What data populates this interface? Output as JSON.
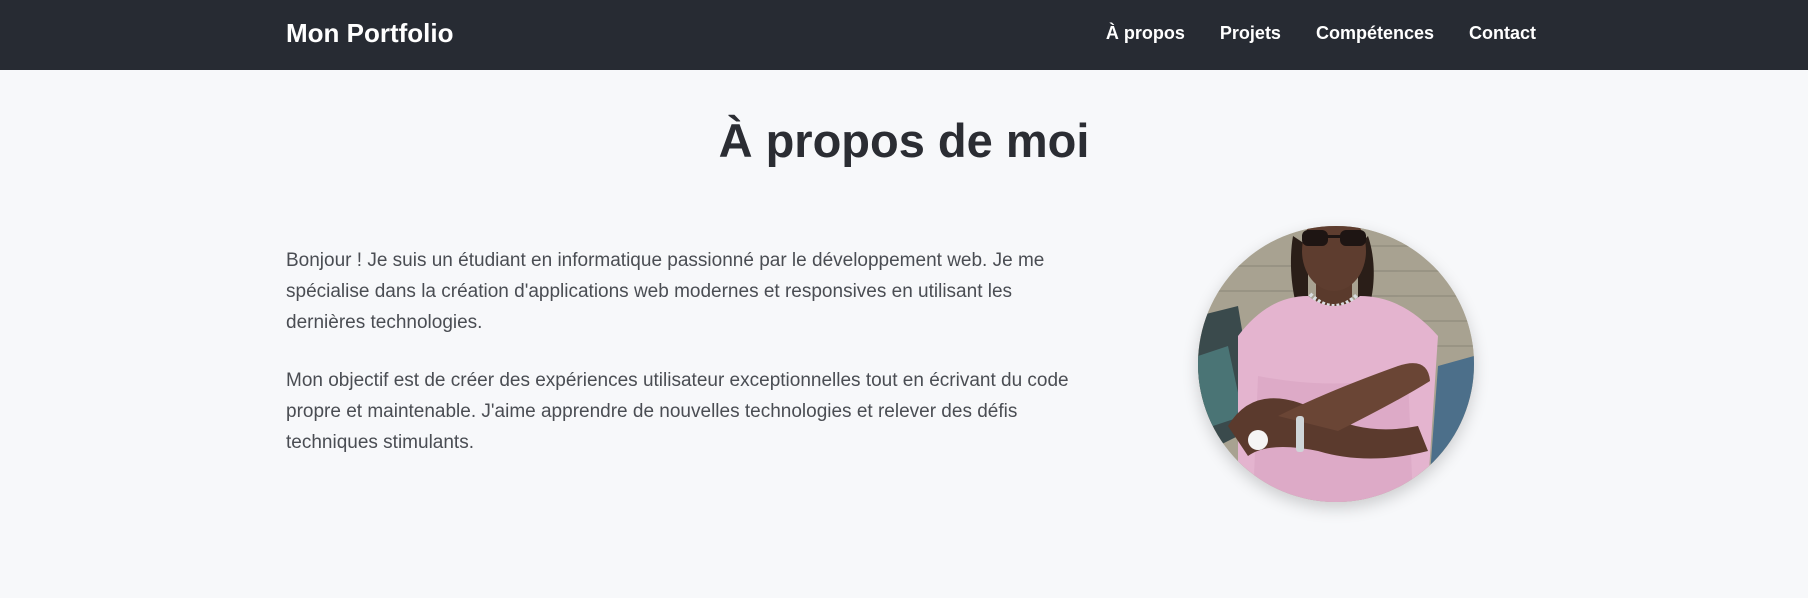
{
  "navbar": {
    "brand": "Mon Portfolio",
    "links": [
      "À propos",
      "Projets",
      "Compétences",
      "Contact"
    ]
  },
  "about": {
    "title": "À propos de moi",
    "paragraphs": [
      "Bonjour ! Je suis un étudiant en informatique passionné par le développement web. Je me spécialise dans la création d'applications web modernes et responsives en utilisant les dernières technologies.",
      "Mon objectif est de créer des expériences utilisateur exceptionnelles tout en écrivant du code propre et maintenable. J'aime apprendre de nouvelles technologies et relever des défis techniques stimulants."
    ]
  },
  "colors": {
    "navbar_bg": "#272b33",
    "page_bg": "#f7f8fa",
    "title": "#2b2d33",
    "body_text": "#4a4d53"
  }
}
